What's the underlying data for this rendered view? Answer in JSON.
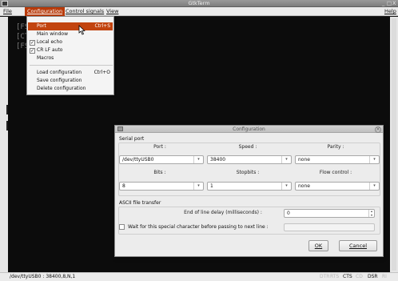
{
  "window": {
    "title": "GtkTerm",
    "controls": [
      "_",
      "□",
      "X"
    ]
  },
  "menubar": {
    "items": [
      "File",
      "Configuration",
      "Control signals",
      "View"
    ],
    "help": "Help"
  },
  "terminal": {
    "lines": [
      "[FS",
      "[CT",
      "[FS"
    ]
  },
  "config_menu": {
    "items": [
      {
        "label": "Port",
        "accel": "Ctrl+S",
        "highlighted": true,
        "checkbox": null
      },
      {
        "label": "Main window",
        "accel": "",
        "checkbox": null
      },
      {
        "label": "Local echo",
        "accel": "",
        "checkbox": true
      },
      {
        "label": "CR LF auto",
        "accel": "",
        "checkbox": true
      },
      {
        "label": "Macros",
        "accel": "",
        "checkbox": null
      },
      {
        "label": "Load configuration",
        "accel": "Ctrl+O",
        "checkbox": null
      },
      {
        "label": "Save configuration",
        "accel": "",
        "checkbox": null
      },
      {
        "label": "Delete configuration",
        "accel": "",
        "checkbox": null
      }
    ]
  },
  "dialog": {
    "title": "Configuration",
    "serial_port": {
      "group_label": "Serial port",
      "port_label": "Port :",
      "port_value": "/dev/ttyUSB0",
      "speed_label": "Speed :",
      "speed_value": "38400",
      "parity_label": "Parity :",
      "parity_value": "none",
      "bits_label": "Bits :",
      "bits_value": "8",
      "stopbits_label": "Stopbits :",
      "stopbits_value": "1",
      "flow_label": "Flow control :",
      "flow_value": "none"
    },
    "ascii": {
      "group_label": "ASCII file transfer",
      "eol_delay_label": "End of line delay (milliseconds) :",
      "eol_delay_value": "0",
      "wait_label": "Wait for this special character before passing to next line :",
      "wait_checked": false
    },
    "ok_label": "OK",
    "cancel_label": "Cancel"
  },
  "statusbar": {
    "port_info": "/dev/ttyUSB0 : 38400,8,N,1",
    "signals": [
      {
        "name": "DTR",
        "active": false
      },
      {
        "name": "RTS",
        "active": false
      },
      {
        "name": "CTS",
        "active": true
      },
      {
        "name": "CD",
        "active": false
      },
      {
        "name": "DSR",
        "active": true
      },
      {
        "name": "RI",
        "active": false
      }
    ]
  },
  "colors": {
    "menu_highlight": "#c2440f",
    "terminal_bg": "#0c0c0c",
    "terminal_fg": "#7a7a7a"
  }
}
